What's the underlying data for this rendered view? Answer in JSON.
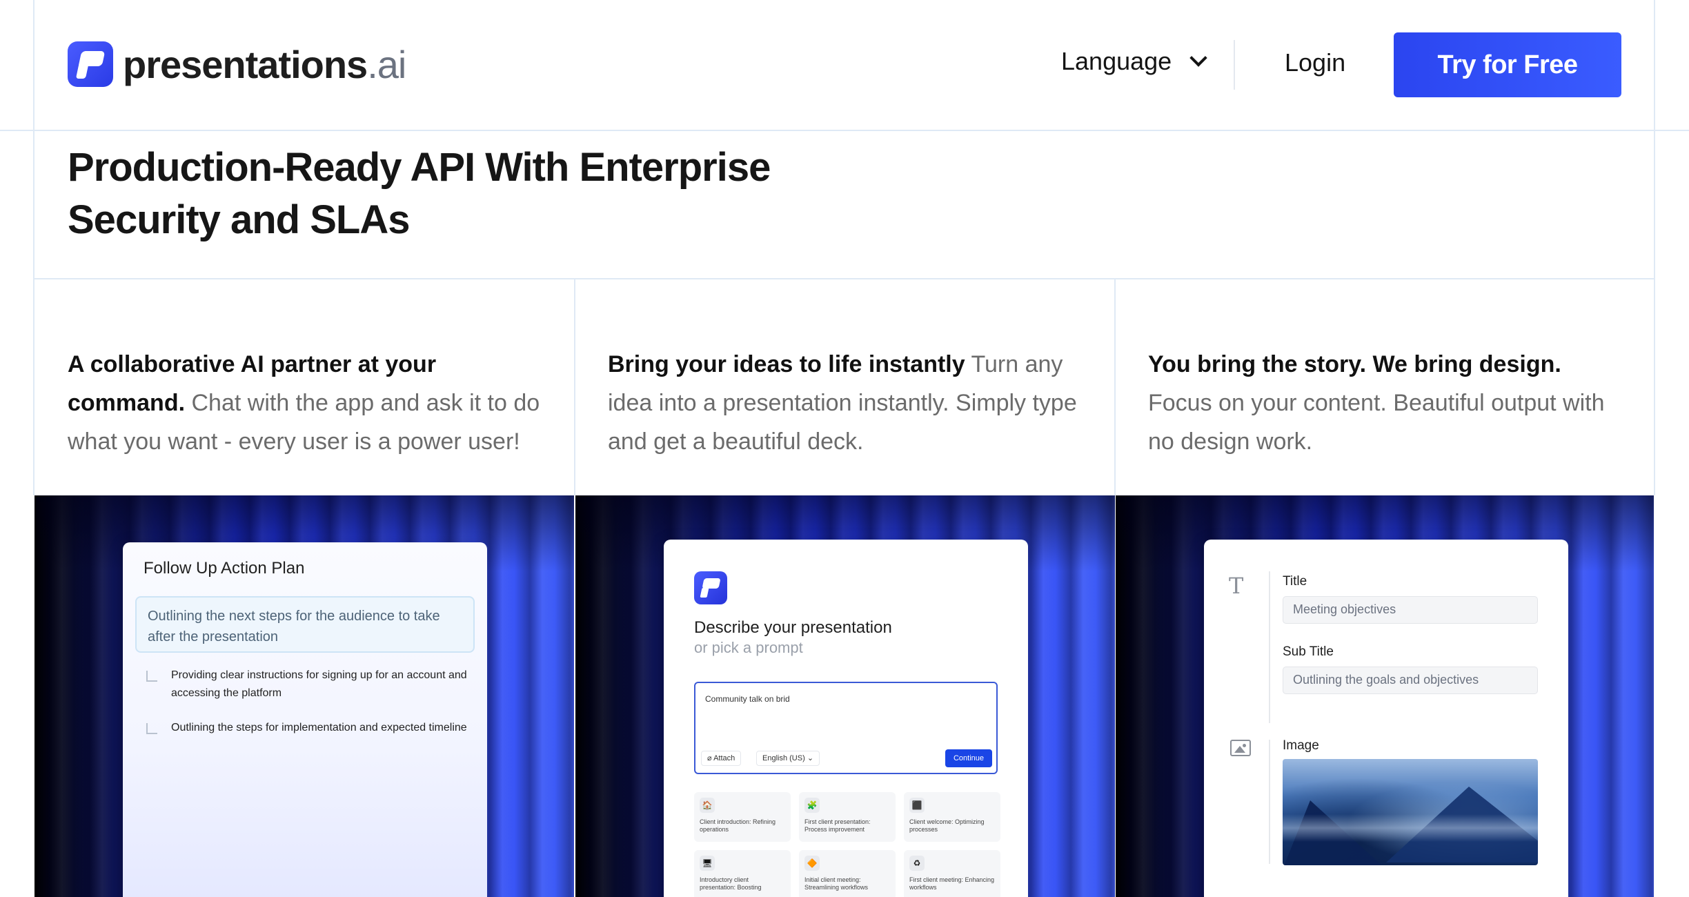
{
  "header": {
    "logo_text": "presentations",
    "logo_suffix": ".ai",
    "language_label": "Language",
    "login_label": "Login",
    "cta_label": "Try for Free"
  },
  "hero": {
    "title_line1": "Production-Ready API With Enterprise",
    "title_line2": "Security and SLAs"
  },
  "features": [
    {
      "heading": "A collaborative AI partner at your command.",
      "body": "Chat with the app and ask it to do what you want - every user is a power user!"
    },
    {
      "heading": "Bring your ideas to life instantly",
      "body": "Turn any idea into a presentation instantly. Simply type and get a beautiful deck."
    },
    {
      "heading": "You bring the story. We bring design.",
      "body": "Focus on your content. Beautiful output with no design work."
    }
  ],
  "panel1": {
    "title": "Follow Up Action Plan",
    "highlight": "Outlining the next steps for the audience to take after the presentation",
    "items": [
      "Providing clear instructions for signing up for an account and accessing the platform",
      "Outlining the steps for implementation and expected timeline"
    ]
  },
  "panel2": {
    "heading": "Describe your presentation",
    "subheading": "or pick a prompt",
    "input_value": "Community talk on brid",
    "attach_label": "Attach",
    "language_select": "English (US)",
    "continue_label": "Continue",
    "prompts": [
      {
        "icon": "🏠",
        "text": "Client introduction: Refining operations"
      },
      {
        "icon": "🧩",
        "text": "First client presentation: Process improvement"
      },
      {
        "icon": "⬛",
        "text": "Client welcome: Optimizing processes"
      },
      {
        "icon": "🖥",
        "text": "Introductory client presentation: Boosting"
      },
      {
        "icon": "🔶",
        "text": "Initial client meeting: Streamlining workflows"
      },
      {
        "icon": "♻",
        "text": "First client meeting: Enhancing workflows"
      }
    ]
  },
  "panel3": {
    "title_label": "Title",
    "title_value": "Meeting objectives",
    "subtitle_label": "Sub Title",
    "subtitle_value": "Outlining the goals and objectives",
    "image_label": "Image"
  },
  "colors": {
    "accent": "#2b45f0",
    "panel_blue": "#2e45f2",
    "border": "#dfe9f5"
  }
}
